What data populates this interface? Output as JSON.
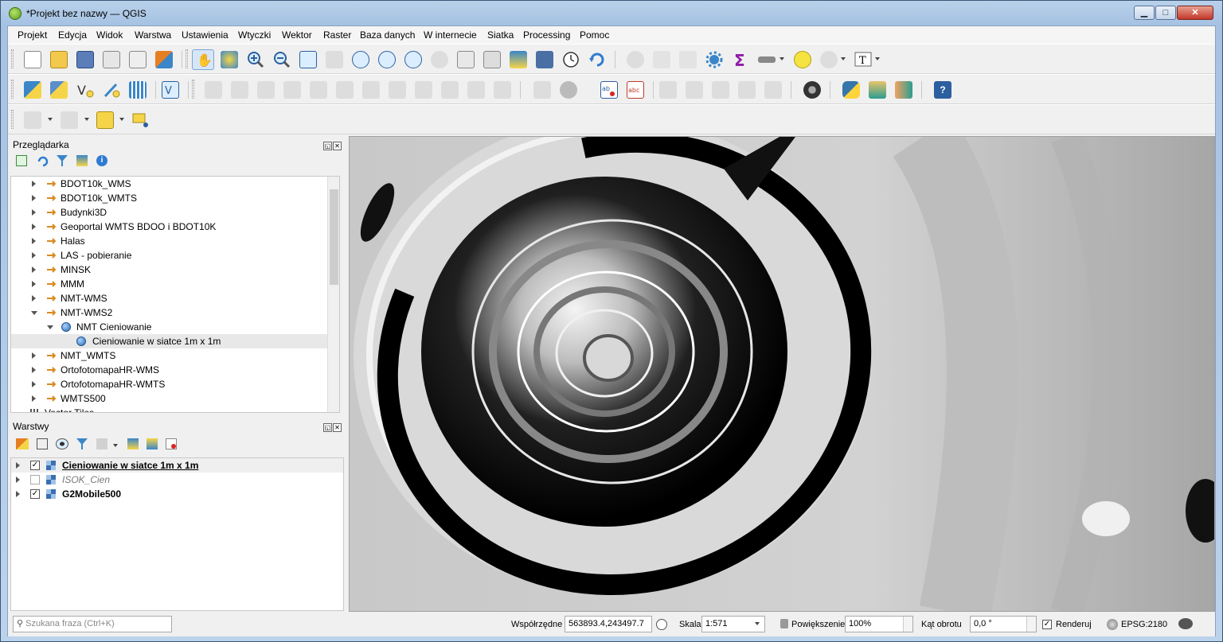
{
  "window": {
    "title": "*Projekt bez nazwy — QGIS"
  },
  "menu": [
    "Projekt",
    "Edycja",
    "Widok",
    "Warstwa",
    "Ustawienia",
    "Wtyczki",
    "Wektor",
    "Raster",
    "Baza danych",
    "W internecie",
    "Siatka",
    "Processing",
    "Pomoc"
  ],
  "browser": {
    "title": "Przeglądarka",
    "items": [
      {
        "label": "BDOT10k_WMS",
        "type": "wms",
        "expanded": false,
        "depth": 0
      },
      {
        "label": "BDOT10k_WMTS",
        "type": "wms",
        "expanded": false,
        "depth": 0
      },
      {
        "label": "Budynki3D",
        "type": "wms",
        "expanded": false,
        "depth": 0
      },
      {
        "label": "Geoportal WMTS BDOO i BDOT10K",
        "type": "wms",
        "expanded": false,
        "depth": 0
      },
      {
        "label": "Halas",
        "type": "wms",
        "expanded": false,
        "depth": 0
      },
      {
        "label": "LAS - pobieranie",
        "type": "wms",
        "expanded": false,
        "depth": 0
      },
      {
        "label": "MINSK",
        "type": "wms",
        "expanded": false,
        "depth": 0
      },
      {
        "label": "MMM",
        "type": "wms",
        "expanded": false,
        "depth": 0
      },
      {
        "label": "NMT-WMS",
        "type": "wms",
        "expanded": false,
        "depth": 0
      },
      {
        "label": "NMT-WMS2",
        "type": "wms",
        "expanded": true,
        "depth": 0
      },
      {
        "label": "NMT Cieniowanie",
        "type": "globe",
        "expanded": true,
        "depth": 1
      },
      {
        "label": "Cieniowanie w siatce 1m x 1m",
        "type": "globe",
        "expanded": null,
        "depth": 2,
        "selected": true
      },
      {
        "label": "NMT_WMTS",
        "type": "wms",
        "expanded": false,
        "depth": 0
      },
      {
        "label": "OrtofotomapaHR-WMS",
        "type": "wms",
        "expanded": false,
        "depth": 0
      },
      {
        "label": "OrtofotomapaHR-WMTS",
        "type": "wms",
        "expanded": false,
        "depth": 0
      },
      {
        "label": "WMTS500",
        "type": "wms",
        "expanded": false,
        "depth": 0
      },
      {
        "label": "Vector Tiles",
        "type": "grid",
        "expanded": false,
        "depth": -1
      }
    ]
  },
  "layers": {
    "title": "Warstwy",
    "items": [
      {
        "label": "Cieniowanie w siatce 1m x 1m",
        "checked": true,
        "style": "bold-underline"
      },
      {
        "label": "ISOK_Cien",
        "checked": false,
        "style": "italic-grey"
      },
      {
        "label": "G2Mobile500",
        "checked": true,
        "style": "bold"
      }
    ]
  },
  "status": {
    "search_placeholder": "Szukana fraza (Ctrl+K)",
    "coord_label": "Współrzędne",
    "coord_value": "563893.4,243497.7",
    "scale_label": "Skala",
    "scale_value": "1:571",
    "zoom_label": "Powiększenie",
    "zoom_value": "100%",
    "rotation_label": "Kąt obrotu",
    "rotation_value": "0,0 °",
    "render_label": "Renderuj",
    "render_checked": true,
    "crs": "EPSG:2180"
  }
}
